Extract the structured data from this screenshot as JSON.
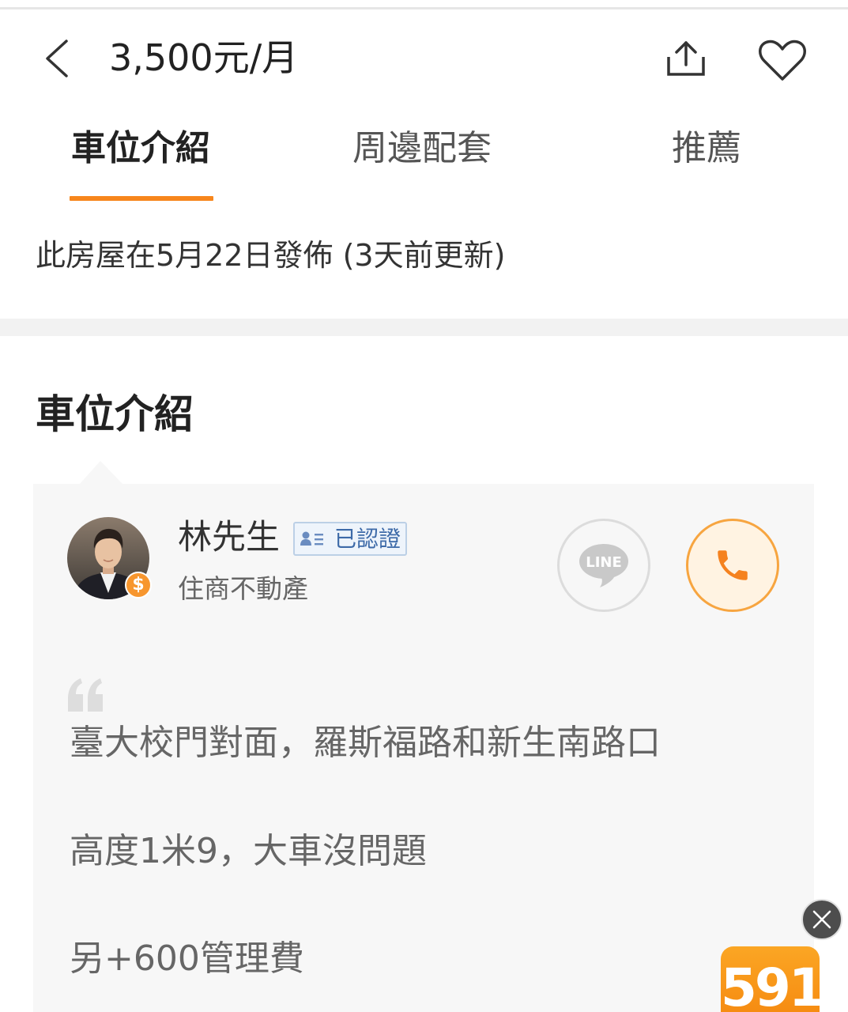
{
  "header": {
    "title": "3,500元/月"
  },
  "tabs": [
    {
      "label": "車位介紹"
    },
    {
      "label": "周邊配套"
    },
    {
      "label": "推薦"
    }
  ],
  "active_tab": 0,
  "publish_info": "此房屋在5月22日發佈 (3天前更新)",
  "section_title": "車位介紹",
  "agent": {
    "name": "林先生",
    "verified_label": "已認證",
    "company": "住商不動產",
    "badge_symbol": "$",
    "line_label": "LINE"
  },
  "description": [
    "臺大校門對面，羅斯福路和新生南路口",
    "高度1米9，大車沒問題",
    "另+600管理費"
  ],
  "ad": {
    "logo_text": "591"
  },
  "icons": {
    "back": "chevron-left-icon",
    "share": "share-icon",
    "favorite": "heart-icon",
    "verified": "id-card-icon",
    "line": "line-icon",
    "phone": "phone-icon",
    "quote": "quote-icon",
    "close": "close-icon"
  },
  "colors": {
    "accent": "#f7861c",
    "text_primary": "#222222",
    "text_secondary": "#666666",
    "card_bg": "#f7f7f7",
    "verified_blue": "#3d6aa8"
  }
}
